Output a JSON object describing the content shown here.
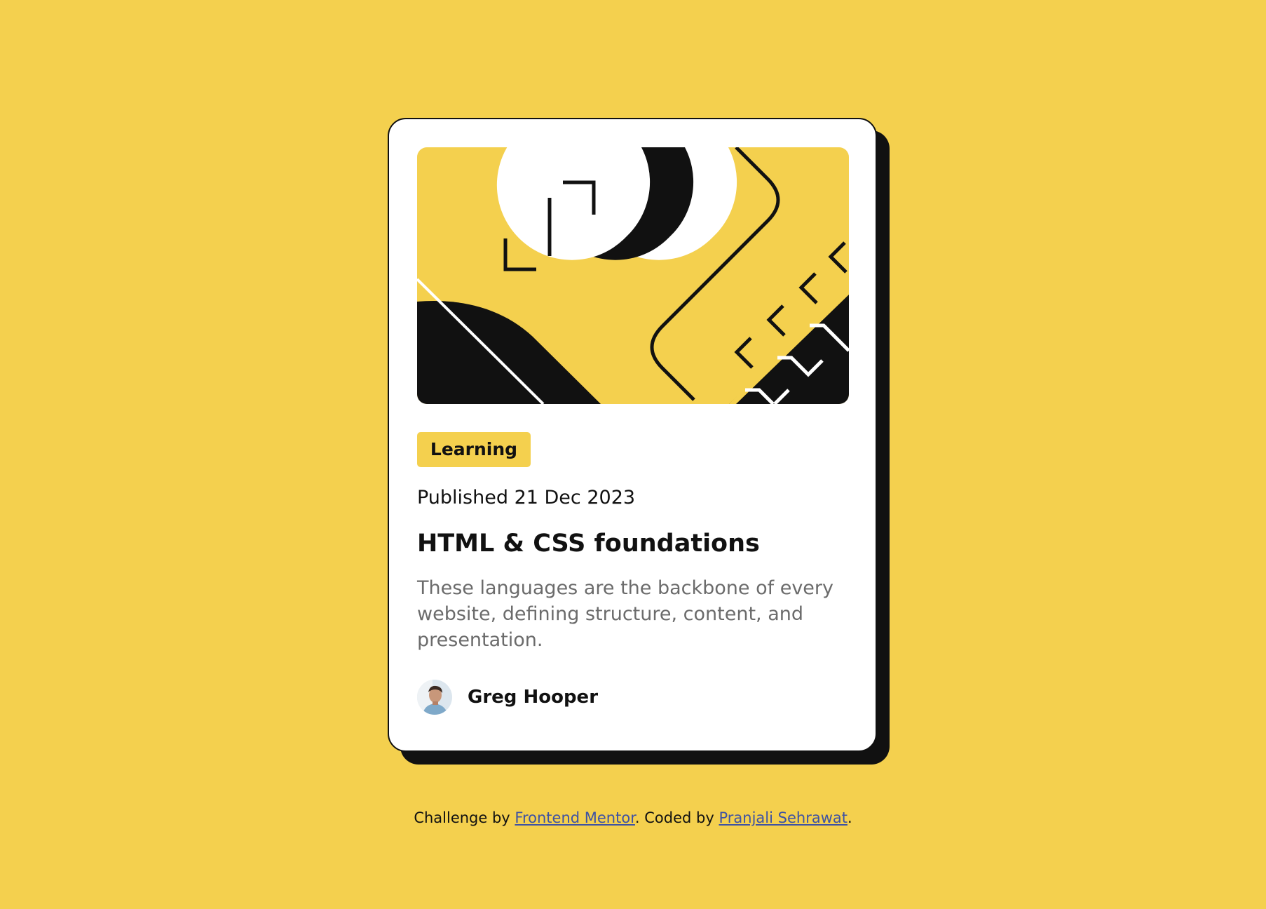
{
  "card": {
    "category": "Learning",
    "published": "Published 21 Dec 2023",
    "title": "HTML & CSS foundations",
    "description": "These languages are the backbone of every website, defining structure, content, and presentation.",
    "author": {
      "name": "Greg Hooper",
      "avatar_icon": "avatar-portrait"
    },
    "hero_icon": "abstract-illustration"
  },
  "attribution": {
    "prefix": "Challenge by ",
    "link1": "Frontend Mentor",
    "middle": ". Coded by ",
    "link2": "Pranjali Sehrawat",
    "suffix": "."
  },
  "colors": {
    "background": "#F4D04E",
    "card": "#FFFFFF",
    "ink": "#111111",
    "muted_text": "#6B6B6B",
    "link": "#3E52A3"
  }
}
